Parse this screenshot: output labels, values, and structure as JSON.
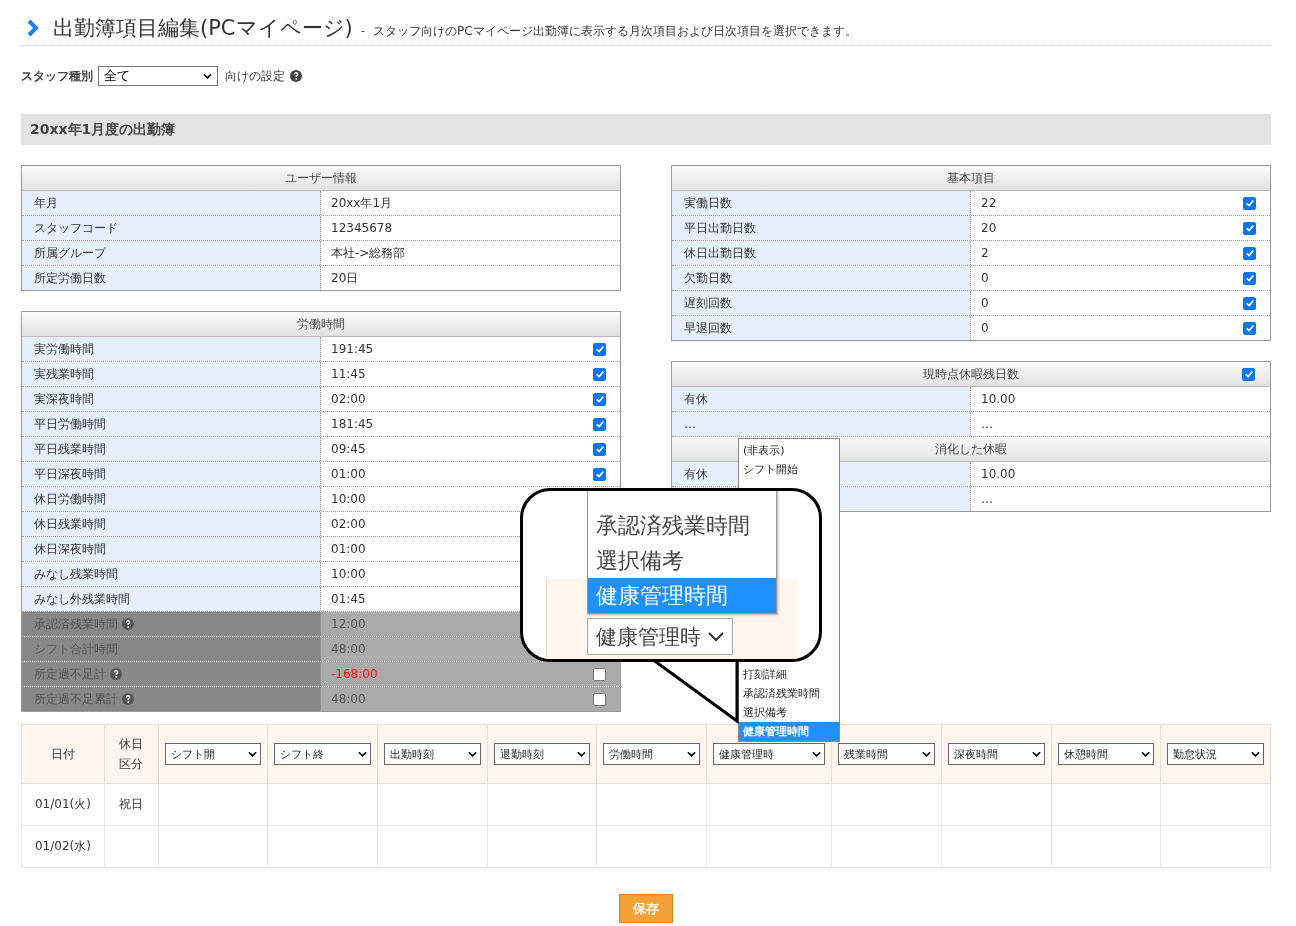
{
  "title": "出勤簿項目編集(PCマイページ)",
  "separator": "-",
  "description": "スタッフ向けのPCマイページ出勤簿に表示する月次項目および日次項目を選択できます。",
  "staff_type": {
    "label": "スタッフ種別",
    "value": "全て",
    "suffix": "向けの設定"
  },
  "month_header": "20xx年1月度の出勤簿",
  "left_panels": [
    {
      "groups": [
        {
          "title": "ユーザー情報",
          "rows": [
            {
              "label": "年月",
              "value": "20xx年1月"
            },
            {
              "label": "スタッフコード",
              "value": "12345678"
            },
            {
              "label": "所属グループ",
              "value": "本社->総務部"
            },
            {
              "label": "所定労働日数",
              "value": "20日"
            }
          ]
        }
      ]
    },
    {
      "groups": [
        {
          "title": "労働時間",
          "rows": [
            {
              "label": "実労働時間",
              "value": "191:45",
              "checked": true,
              "disabled": false,
              "help": false,
              "alert": false
            },
            {
              "label": "実残業時間",
              "value": "11:45",
              "checked": true,
              "disabled": false,
              "help": false,
              "alert": false
            },
            {
              "label": "実深夜時間",
              "value": "02:00",
              "checked": true,
              "disabled": false,
              "help": false,
              "alert": false
            },
            {
              "label": "平日労働時間",
              "value": "181:45",
              "checked": true,
              "disabled": false,
              "help": false,
              "alert": false
            },
            {
              "label": "平日残業時間",
              "value": "09:45",
              "checked": true,
              "disabled": false,
              "help": false,
              "alert": false
            },
            {
              "label": "平日深夜時間",
              "value": "01:00",
              "checked": true,
              "disabled": false,
              "help": false,
              "alert": false
            },
            {
              "label": "休日労働時間",
              "value": "10:00",
              "disabled": false,
              "help": false,
              "alert": false
            },
            {
              "label": "休日残業時間",
              "value": "02:00",
              "disabled": false,
              "help": false,
              "alert": false
            },
            {
              "label": "休日深夜時間",
              "value": "01:00",
              "disabled": false,
              "help": false,
              "alert": false
            },
            {
              "label": "みなし残業時間",
              "value": "10:00",
              "disabled": false,
              "help": false,
              "alert": false
            },
            {
              "label": "みなし外残業時間",
              "value": "01:45",
              "disabled": false,
              "help": false,
              "alert": false
            },
            {
              "label": "承認済残業時間",
              "value": "12:00",
              "disabled": true,
              "help": true,
              "alert": false
            },
            {
              "label": "シフト合計時間",
              "value": "48:00",
              "disabled": true,
              "help": false,
              "alert": false
            },
            {
              "label": "所定過不足計",
              "value": "-168:00",
              "checked": false,
              "disabled": true,
              "help": true,
              "alert": true
            },
            {
              "label": "所定過不足累計",
              "value": "48:00",
              "checked": false,
              "disabled": true,
              "help": true,
              "alert": false
            }
          ]
        }
      ]
    }
  ],
  "right_panels": [
    {
      "groups": [
        {
          "title": "基本項目",
          "rows": [
            {
              "label": "実働日数",
              "value": "22",
              "checked": true
            },
            {
              "label": "平日出勤日数",
              "value": "20",
              "checked": true
            },
            {
              "label": "休日出勤日数",
              "value": "2",
              "checked": true
            },
            {
              "label": "欠勤日数",
              "value": "0",
              "checked": true
            },
            {
              "label": "遅刻回数",
              "value": "0",
              "checked": true
            },
            {
              "label": "早退回数",
              "value": "0",
              "checked": true
            }
          ]
        }
      ]
    },
    {
      "groups": [
        {
          "title": "現時点休暇残日数",
          "checked": true,
          "rows": [
            {
              "label": "有休",
              "value": "10.00"
            },
            {
              "label": "…",
              "value": "…"
            }
          ]
        },
        {
          "title": "消化した休暇",
          "rows": [
            {
              "label": "有休",
              "value": "10.00"
            },
            {
              "value": "…"
            }
          ]
        }
      ]
    }
  ],
  "daily_table": {
    "columns": [
      {
        "kind": "text",
        "label": "日付"
      },
      {
        "kind": "text",
        "label": "休日区分"
      },
      {
        "kind": "select",
        "value": "シフト開"
      },
      {
        "kind": "select",
        "value": "シフト終"
      },
      {
        "kind": "select",
        "value": "出勤時刻"
      },
      {
        "kind": "select",
        "value": "退勤時刻"
      },
      {
        "kind": "select",
        "value": "労働時間"
      },
      {
        "kind": "select",
        "value": "健康管理時"
      },
      {
        "kind": "select",
        "value": "残業時間"
      },
      {
        "kind": "select",
        "value": "深夜時間"
      },
      {
        "kind": "select",
        "value": "休憩時間"
      },
      {
        "kind": "select",
        "value": "勤怠状況"
      }
    ],
    "rows": [
      {
        "date": "01/01(火)",
        "holiday": "祝日"
      },
      {
        "date": "01/02(水)"
      }
    ]
  },
  "open_dropdown": {
    "top_items": [
      {
        "label": "(非表示)",
        "selected": false
      },
      {
        "label": "シフト開始",
        "selected": false
      }
    ],
    "bottom_items": [
      {
        "label": "打刻詳細",
        "selected": false
      },
      {
        "label": "承認済残業時間",
        "selected": false
      },
      {
        "label": "選択備考",
        "selected": false
      },
      {
        "label": "健康管理時間",
        "selected": true
      }
    ]
  },
  "callout": {
    "items": [
      {
        "label": "承認済残業時間",
        "selected": false
      },
      {
        "label": "選択備考",
        "selected": false
      },
      {
        "label": "健康管理時間",
        "selected": true
      }
    ],
    "select_value": "健康管理時"
  },
  "save_button": "保存"
}
